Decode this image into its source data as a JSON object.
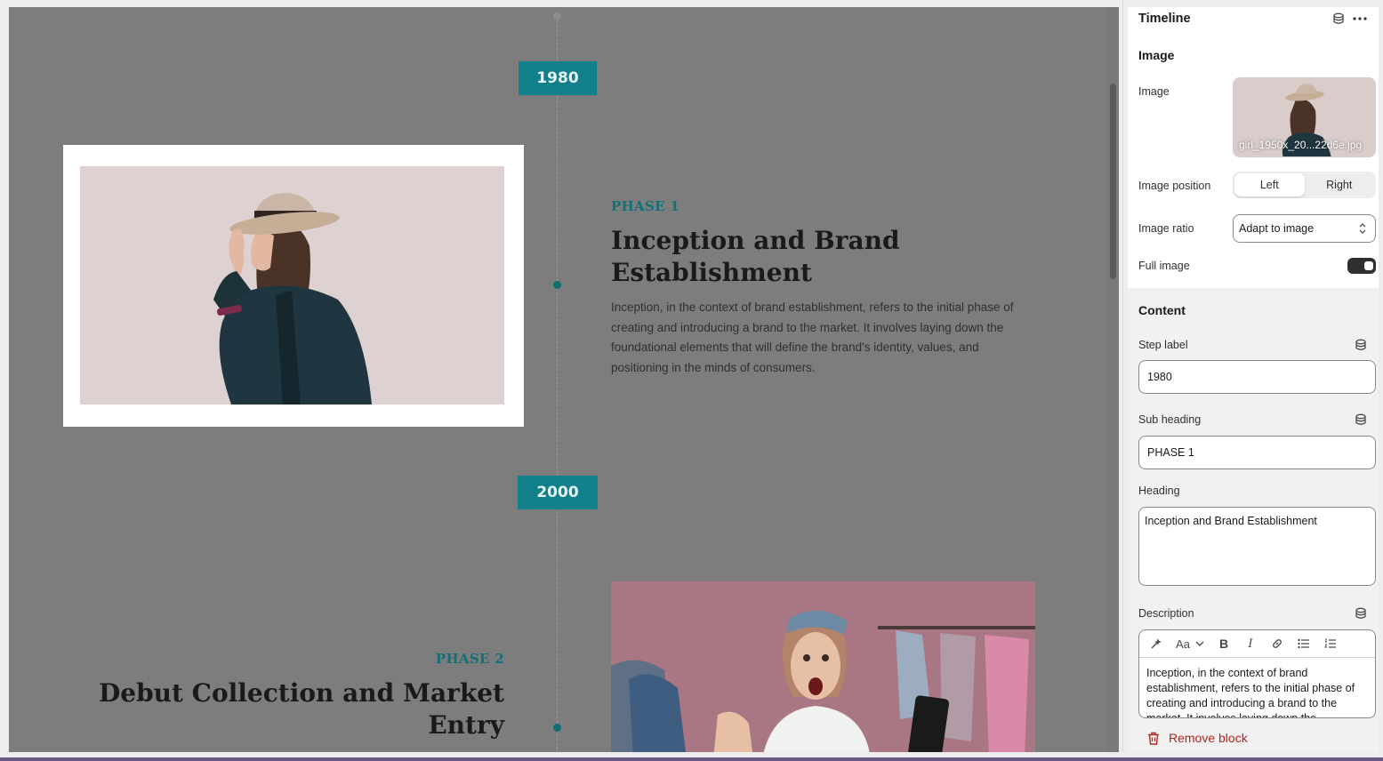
{
  "preview": {
    "steps": [
      {
        "year": "1980",
        "sub_heading": "PHASE 1",
        "heading_lines": [
          "Inception and Brand",
          "Establishment"
        ],
        "description": "Inception, in the context of brand establishment, refers to the initial phase of creating and introducing a brand to the market. It involves laying down the foundational elements that will define the brand's identity, values, and positioning in the minds of consumers."
      },
      {
        "year": "2000",
        "sub_heading": "PHASE 2",
        "heading_lines": [
          "Debut Collection and Market",
          "Entry"
        ]
      }
    ]
  },
  "sidebar": {
    "title": "Timeline",
    "image_section": {
      "title": "Image",
      "image_label": "Image",
      "image_filename": "girl_1950x_20...22d6e.jpg",
      "position_label": "Image position",
      "position_options": [
        "Left",
        "Right"
      ],
      "position_selected": "Left",
      "ratio_label": "Image ratio",
      "ratio_value": "Adapt to image",
      "full_image_label": "Full image",
      "full_image_on": true
    },
    "content_section": {
      "title": "Content",
      "step_label_label": "Step label",
      "step_label_value": "1980",
      "sub_heading_label": "Sub heading",
      "sub_heading_value": "PHASE 1",
      "heading_label": "Heading",
      "heading_value": "Inception and Brand Establishment",
      "description_label": "Description",
      "description_value": "Inception, in the context of brand establishment, refers to the initial phase of creating and introducing a brand to the market. It involves laying down the",
      "rte_font_label": "Aa"
    },
    "remove_label": "Remove block"
  },
  "colors": {
    "accent_teal": "#12808a",
    "danger": "#b3261e"
  }
}
